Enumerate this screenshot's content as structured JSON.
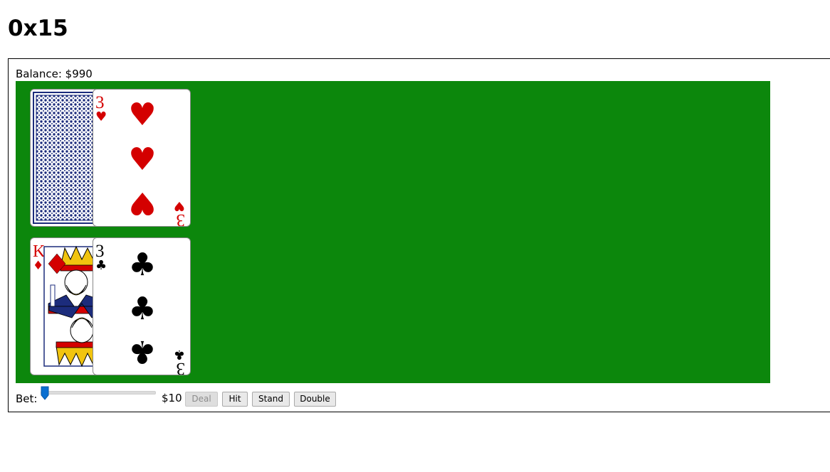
{
  "page": {
    "title": "0x15"
  },
  "balance": {
    "label": "Balance: $990"
  },
  "dealer_hand": [
    {
      "face_down": true,
      "rank": "",
      "suit": "",
      "color": "#1c2c7c"
    },
    {
      "face_down": false,
      "rank": "3",
      "suit": "♥",
      "color": "#d40000"
    }
  ],
  "player_hand": [
    {
      "face_down": false,
      "rank": "K",
      "suit": "♦",
      "color": "#d40000"
    },
    {
      "face_down": false,
      "rank": "3",
      "suit": "♣",
      "color": "#000000"
    }
  ],
  "controls": {
    "bet_label": "Bet:",
    "bet_value": "$10",
    "bet_slider_fraction": 0.0,
    "deal": "Deal",
    "hit": "Hit",
    "stand": "Stand",
    "double": "Double"
  },
  "colors": {
    "felt": "#0c870c",
    "slider_thumb": "#0a6fd1",
    "red_suit": "#d40000",
    "card_back": "#1c2c7c"
  }
}
